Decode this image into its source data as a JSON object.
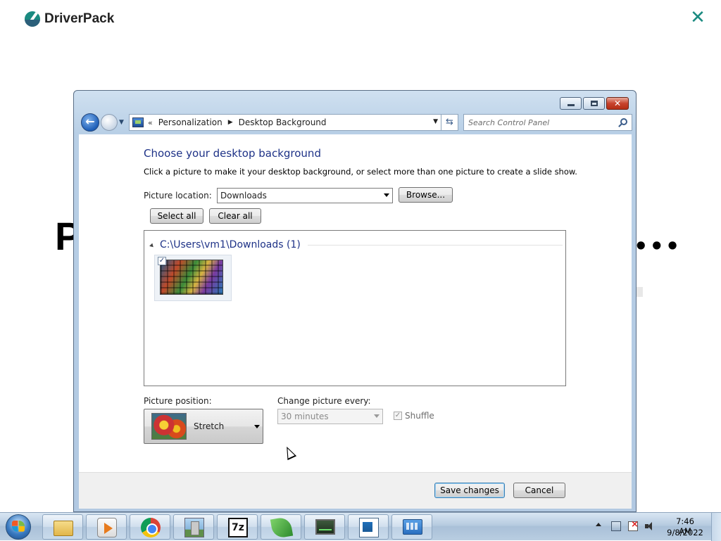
{
  "background_app": {
    "logo_text": "DriverPack",
    "heading_partial": "P",
    "ellipsis": "•••"
  },
  "window": {
    "controls": {
      "minimize": "",
      "maximize": "",
      "close": "✕"
    },
    "address": {
      "chevron": "«",
      "crumbs": [
        "Personalization",
        "Desktop Background"
      ],
      "search_placeholder": "Search Control Panel"
    },
    "title": "Choose your desktop background",
    "subtitle": "Click a picture to make it your desktop background, or select more than one picture to create a slide show.",
    "picture_location": {
      "label": "Picture location:",
      "value": "Downloads"
    },
    "buttons": {
      "browse": "Browse...",
      "select_all": "Select all",
      "clear_all": "Clear all",
      "save": "Save changes",
      "cancel": "Cancel"
    },
    "gallery": {
      "group_title": "C:\\Users\\vm1\\Downloads (1)",
      "thumbnails": [
        {
          "checked": true,
          "check_mark": "✓"
        }
      ]
    },
    "picture_position": {
      "label": "Picture position:",
      "value": "Stretch"
    },
    "change_picture": {
      "label": "Change picture every:",
      "value": "30 minutes",
      "disabled": true
    },
    "shuffle": {
      "label": "Shuffle",
      "checked": true,
      "disabled": true,
      "check_mark": "✓"
    }
  },
  "taskbar": {
    "apps": [
      "windows-explorer",
      "media-player",
      "google-chrome",
      "castle-app",
      "7-zip",
      "leaf-app",
      "system-monitor",
      "document-viewer",
      "control-panel"
    ],
    "seven_zip_label": "7z",
    "clock": {
      "time": "7:46 AM",
      "date": "9/8/2022"
    }
  },
  "colors": {
    "accent_title": "#1e3287",
    "driverpack_teal": "#1a8a80",
    "window_frame": "#b8cfe6",
    "close_button": "#c7432d"
  }
}
